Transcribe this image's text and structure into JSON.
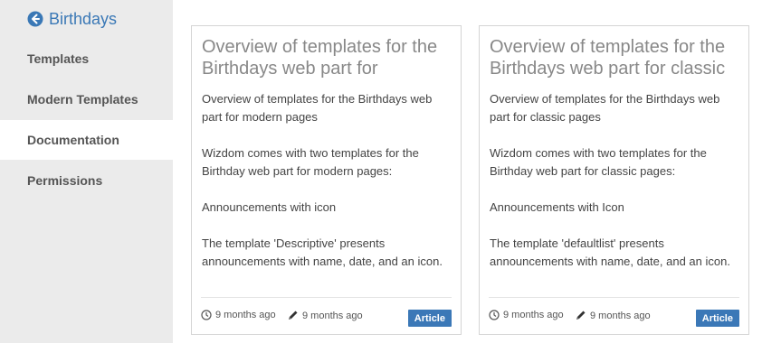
{
  "sidebar": {
    "back_title": "Birthdays",
    "items": [
      {
        "label": "Templates"
      },
      {
        "label": "Modern Templates"
      },
      {
        "label": "Documentation"
      },
      {
        "label": "Permissions"
      }
    ],
    "active_item": "Documentation"
  },
  "cards": [
    {
      "title": "Overview of templates for the Birthdays web part for",
      "paragraphs": [
        "Overview of  templates for the Birthdays web part for modern pages",
        "Wizdom comes with two templates for the Birthday web part for modern pages:",
        "Announcements with icon",
        "The template 'Descriptive' presents announcements with name, date, and an icon."
      ],
      "created": "9 months ago",
      "modified": "9 months ago",
      "badge": "Article"
    },
    {
      "title": "Overview of templates for the Birthdays web part for classic",
      "paragraphs": [
        "Overview of  templates for the Birthdays web part for classic pages",
        "Wizdom comes with two templates for the Birthday web part for classic pages:",
        "Announcements with Icon",
        "The template 'defaultlist' presents announcements with name, date, and an icon."
      ],
      "created": "9 months ago",
      "modified": "9 months ago",
      "badge": "Article"
    }
  ],
  "colors": {
    "accent": "#3b78b7",
    "sidebar_bg": "#ebebeb"
  }
}
